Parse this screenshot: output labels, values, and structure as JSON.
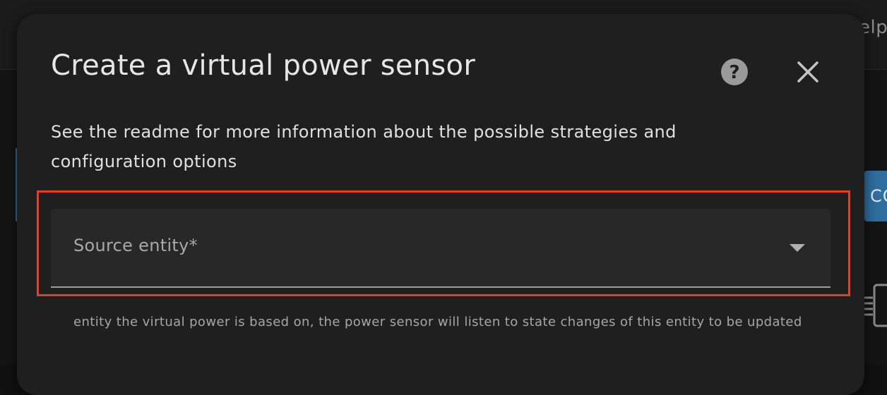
{
  "background": {
    "top_right_text": "Helpe",
    "side_button_label": "CO",
    "accent_color": "#2f6e9f"
  },
  "dialog": {
    "title": "Create a virtual power sensor",
    "help_icon": "help-circle-icon",
    "close_icon": "close-icon",
    "description": "See the readme for more information about the possible strategies and configuration options",
    "fields": {
      "source_entity": {
        "label": "Source entity*",
        "value": "",
        "helper": "entity the virtual power is based on, the power sensor will listen to state changes of this entity to be updated"
      }
    }
  },
  "highlight": {
    "color": "#e0402a"
  }
}
